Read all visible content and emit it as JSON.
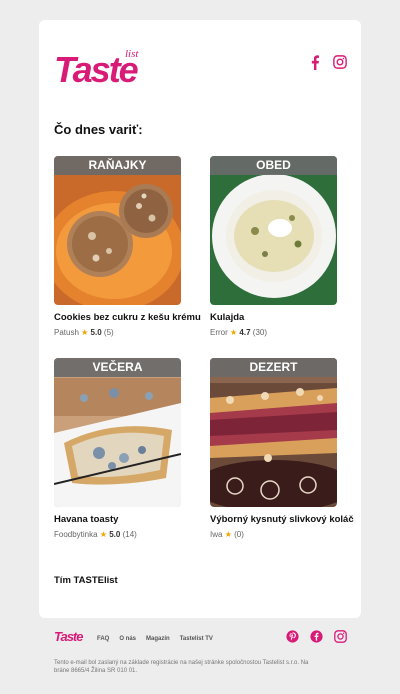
{
  "brand": {
    "logo_text": "Taste",
    "logo_sub": "list",
    "accent": "#d81b77"
  },
  "header": {
    "social": [
      "facebook-icon",
      "instagram-icon"
    ]
  },
  "main": {
    "heading": "Čo dnes variť:",
    "items": [
      {
        "category": "RAŇAJKY",
        "title": "Cookies bez cukru z kešu krému",
        "author": "Patush",
        "rating": "5.0",
        "count": "(5)"
      },
      {
        "category": "OBED",
        "title": "Kulajda",
        "author": "Error",
        "rating": "4.7",
        "count": "(30)"
      },
      {
        "category": "VEČERA",
        "title": "Havana toasty",
        "author": "Foodbytinka",
        "rating": "5.0",
        "count": "(14)"
      },
      {
        "category": "DEZERT",
        "title": "Výborný kysnutý slivkový koláč",
        "author": "Iwa",
        "rating": "",
        "count": "(0)"
      }
    ],
    "signoff": "Tím TASTElist"
  },
  "footer": {
    "logo_text": "Taste",
    "nav": [
      "FAQ",
      "O nás",
      "Magazín",
      "Tastelist TV"
    ],
    "social": [
      "pinterest-icon",
      "facebook-icon",
      "instagram-icon"
    ],
    "legal": "Tento e-mail bol zaslaný na základe registrácie na našej stránke spoločnostou Tastelist s.r.o. Na bráne 8665/4 Žilina SR 010 01."
  }
}
